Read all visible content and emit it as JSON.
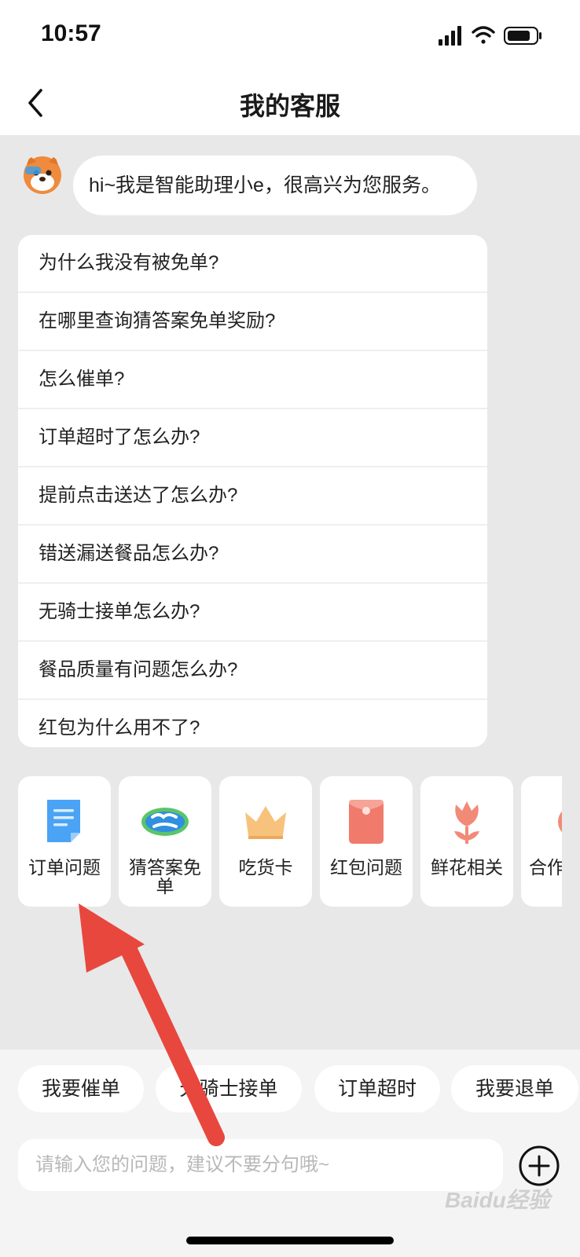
{
  "status_bar": {
    "time": "10:57"
  },
  "header": {
    "title": "我的客服"
  },
  "chat": {
    "greeting": "hi~我是智能助理小e，很高兴为您服务。",
    "faq": [
      "为什么我没有被免单?",
      "在哪里查询猜答案免单奖励?",
      "怎么催单?",
      "订单超时了怎么办?",
      "提前点击送达了怎么办?",
      "错送漏送餐品怎么办?",
      "无骑士接单怎么办?",
      "餐品质量有问题怎么办?",
      "红包为什么用不了?"
    ],
    "categories": [
      {
        "label": "订单问题",
        "icon": "document-icon"
      },
      {
        "label": "猜答案免单",
        "icon": "free-order-badge-icon"
      },
      {
        "label": "吃货卡",
        "icon": "crown-icon"
      },
      {
        "label": "红包问题",
        "icon": "red-envelope-icon"
      },
      {
        "label": "鲜花相关",
        "icon": "flower-icon"
      },
      {
        "label": "合作",
        "icon": "cooperation-icon"
      }
    ]
  },
  "quick_replies": [
    "我要催单",
    "无骑士接单",
    "订单超时",
    "我要退单"
  ],
  "input": {
    "placeholder": "请输入您的问题，建议不要分句哦~"
  },
  "watermark": {
    "text": "Baidu经验"
  },
  "colors": {
    "accent_red": "#e8473e",
    "background": "#e8e8e8"
  }
}
